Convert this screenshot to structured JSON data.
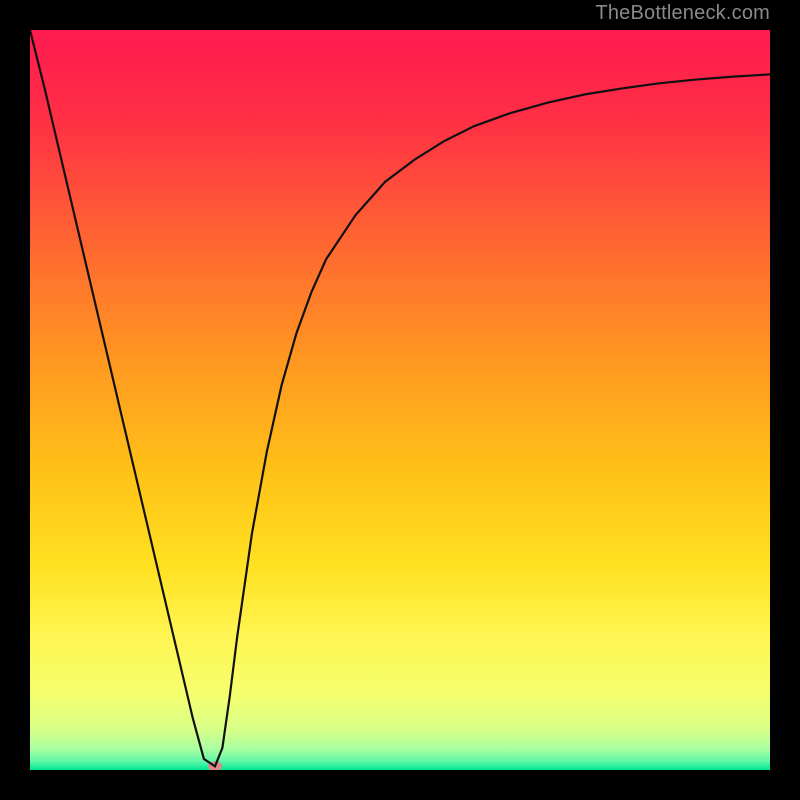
{
  "watermark": "TheBottleneck.com",
  "chart_data": {
    "type": "line",
    "title": "",
    "xlabel": "",
    "ylabel": "",
    "xlim": [
      0,
      100
    ],
    "ylim": [
      0,
      100
    ],
    "grid": false,
    "legend": false,
    "background_gradient": {
      "stops": [
        {
          "offset": 0.0,
          "color": "#ff1a4f"
        },
        {
          "offset": 0.12,
          "color": "#ff2f45"
        },
        {
          "offset": 0.3,
          "color": "#ff6a30"
        },
        {
          "offset": 0.45,
          "color": "#ff9920"
        },
        {
          "offset": 0.6,
          "color": "#ffc218"
        },
        {
          "offset": 0.72,
          "color": "#ffe020"
        },
        {
          "offset": 0.82,
          "color": "#fff552"
        },
        {
          "offset": 0.9,
          "color": "#f5ff70"
        },
        {
          "offset": 0.945,
          "color": "#d8ff88"
        },
        {
          "offset": 0.972,
          "color": "#a8ffa0"
        },
        {
          "offset": 0.988,
          "color": "#60f7a8"
        },
        {
          "offset": 1.0,
          "color": "#00e893"
        }
      ]
    },
    "series": [
      {
        "name": "bottleneck-curve",
        "color": "#111111",
        "x": [
          0,
          2,
          4,
          6,
          8,
          10,
          12,
          14,
          16,
          18,
          20,
          22,
          23.5,
          25,
          26,
          27,
          28,
          30,
          32,
          34,
          36,
          38,
          40,
          44,
          48,
          52,
          56,
          60,
          65,
          70,
          75,
          80,
          85,
          90,
          95,
          100
        ],
        "y": [
          100,
          92,
          83.5,
          75,
          66.5,
          58,
          49.5,
          41,
          32.5,
          24,
          15.5,
          7,
          1.5,
          0.5,
          3,
          10,
          18,
          32,
          43,
          52,
          59,
          64.5,
          69,
          75,
          79.5,
          82.5,
          85,
          87,
          88.8,
          90.2,
          91.3,
          92.1,
          92.8,
          93.3,
          93.7,
          94
        ]
      }
    ],
    "marker": {
      "x": 25,
      "y": 0.5,
      "color": "#d98b88",
      "rx": 7,
      "ry": 5
    }
  }
}
